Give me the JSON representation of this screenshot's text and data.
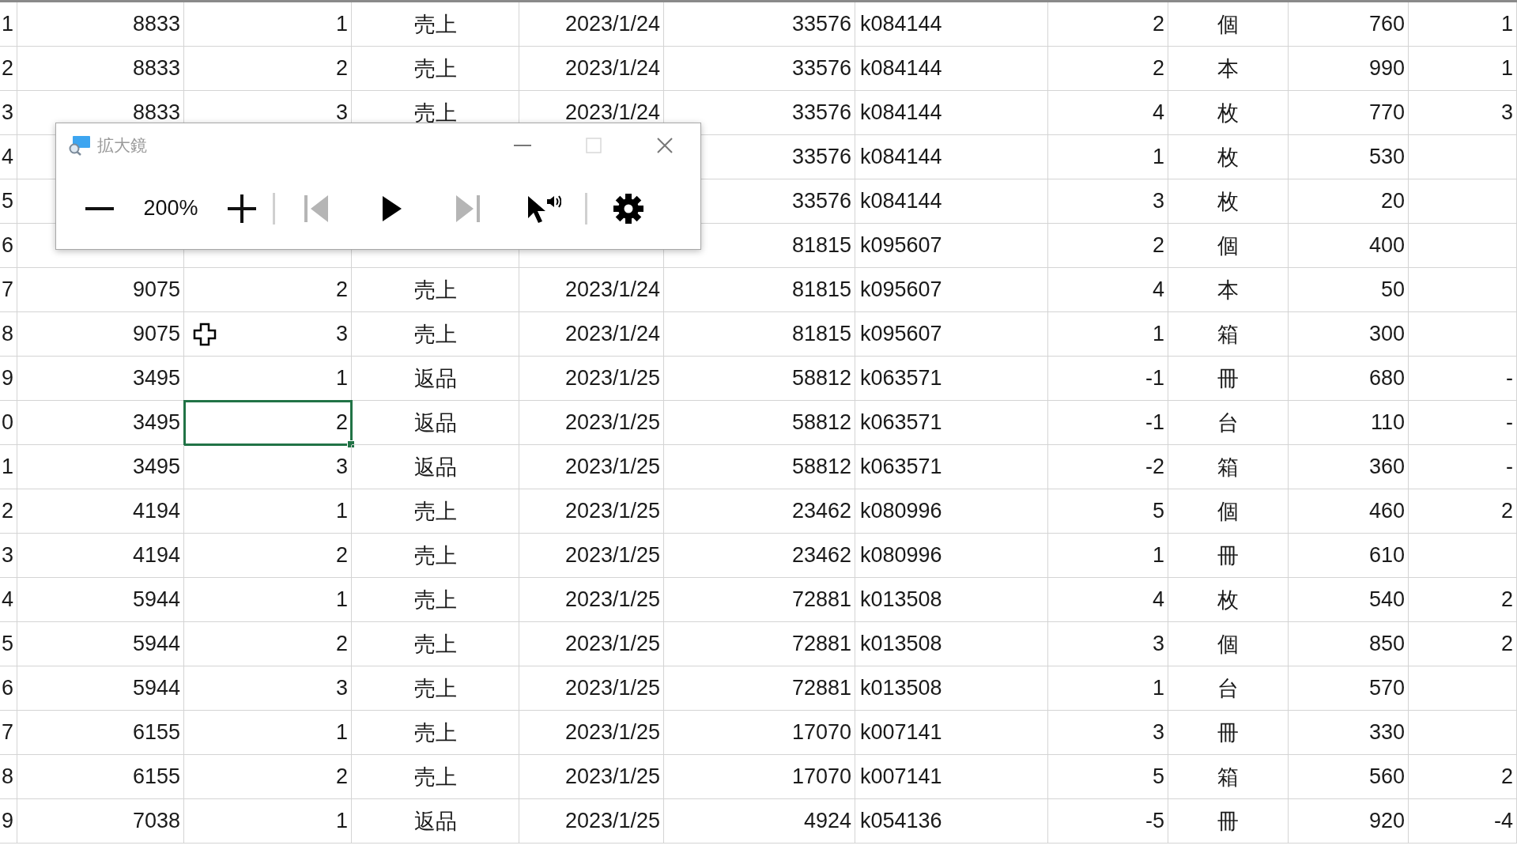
{
  "sheet": {
    "rows": [
      {
        "cells": [
          {
            "text": "1",
            "selected": false
          },
          {
            "text": "8833",
            "selected": false
          },
          {
            "text": "1",
            "selected": false
          },
          {
            "text": "売上",
            "selected": false
          },
          {
            "text": "2023/1/24",
            "selected": false
          },
          {
            "text": "33576",
            "selected": false
          },
          {
            "text": "k084144",
            "selected": false
          },
          {
            "text": "2",
            "selected": false
          },
          {
            "text": "個",
            "selected": false
          },
          {
            "text": "760",
            "selected": false
          },
          {
            "text": "1",
            "selected": false
          }
        ]
      },
      {
        "cells": [
          {
            "text": "2",
            "selected": false
          },
          {
            "text": "8833",
            "selected": false
          },
          {
            "text": "2",
            "selected": false
          },
          {
            "text": "売上",
            "selected": false
          },
          {
            "text": "2023/1/24",
            "selected": false
          },
          {
            "text": "33576",
            "selected": false
          },
          {
            "text": "k084144",
            "selected": false
          },
          {
            "text": "2",
            "selected": false
          },
          {
            "text": "本",
            "selected": false
          },
          {
            "text": "990",
            "selected": false
          },
          {
            "text": "1",
            "selected": false
          }
        ]
      },
      {
        "cells": [
          {
            "text": "3",
            "selected": false
          },
          {
            "text": "8833",
            "selected": false
          },
          {
            "text": "3",
            "selected": false
          },
          {
            "text": "売上",
            "selected": false
          },
          {
            "text": "2023/1/24",
            "selected": false
          },
          {
            "text": "33576",
            "selected": false
          },
          {
            "text": "k084144",
            "selected": false
          },
          {
            "text": "4",
            "selected": false
          },
          {
            "text": "枚",
            "selected": false
          },
          {
            "text": "770",
            "selected": false
          },
          {
            "text": "3",
            "selected": false
          }
        ]
      },
      {
        "cells": [
          {
            "text": "4",
            "selected": false
          },
          null,
          null,
          null,
          null,
          {
            "text": "33576",
            "selected": false
          },
          {
            "text": "k084144",
            "selected": false
          },
          {
            "text": "1",
            "selected": false
          },
          {
            "text": "枚",
            "selected": false
          },
          {
            "text": "530",
            "selected": false
          },
          null
        ]
      },
      {
        "cells": [
          {
            "text": "5",
            "selected": false
          },
          null,
          null,
          null,
          null,
          {
            "text": "33576",
            "selected": false
          },
          {
            "text": "k084144",
            "selected": false
          },
          {
            "text": "3",
            "selected": false
          },
          {
            "text": "枚",
            "selected": false
          },
          {
            "text": "20",
            "selected": false
          },
          null
        ]
      },
      {
        "cells": [
          {
            "text": "6",
            "selected": false
          },
          null,
          null,
          null,
          null,
          {
            "text": "81815",
            "selected": false
          },
          {
            "text": "k095607",
            "selected": false
          },
          {
            "text": "2",
            "selected": false
          },
          {
            "text": "個",
            "selected": false
          },
          {
            "text": "400",
            "selected": false
          },
          null
        ]
      },
      {
        "cells": [
          {
            "text": "7",
            "selected": false
          },
          {
            "text": "9075",
            "selected": false
          },
          {
            "text": "2",
            "selected": false
          },
          {
            "text": "売上",
            "selected": false
          },
          {
            "text": "2023/1/24",
            "selected": false
          },
          {
            "text": "81815",
            "selected": false
          },
          {
            "text": "k095607",
            "selected": false
          },
          {
            "text": "4",
            "selected": false
          },
          {
            "text": "本",
            "selected": false
          },
          {
            "text": "50",
            "selected": false
          },
          null
        ]
      },
      {
        "cells": [
          {
            "text": "8",
            "selected": false
          },
          {
            "text": "9075",
            "selected": false
          },
          {
            "text": "3",
            "selected": false
          },
          {
            "text": "売上",
            "selected": false
          },
          {
            "text": "2023/1/24",
            "selected": false
          },
          {
            "text": "81815",
            "selected": false
          },
          {
            "text": "k095607",
            "selected": false
          },
          {
            "text": "1",
            "selected": false
          },
          {
            "text": "箱",
            "selected": false
          },
          {
            "text": "300",
            "selected": false
          },
          null
        ]
      },
      {
        "cells": [
          {
            "text": "9",
            "selected": false
          },
          {
            "text": "3495",
            "selected": false
          },
          {
            "text": "1",
            "selected": false
          },
          {
            "text": "返品",
            "selected": false
          },
          {
            "text": "2023/1/25",
            "selected": false
          },
          {
            "text": "58812",
            "selected": false
          },
          {
            "text": "k063571",
            "selected": false
          },
          {
            "text": "-1",
            "selected": false
          },
          {
            "text": "冊",
            "selected": false
          },
          {
            "text": "680",
            "selected": false
          },
          {
            "text": "-",
            "selected": false
          }
        ]
      },
      {
        "cells": [
          {
            "text": "0",
            "selected": false
          },
          {
            "text": "3495",
            "selected": false
          },
          {
            "text": "2",
            "selected": true
          },
          {
            "text": "返品",
            "selected": false
          },
          {
            "text": "2023/1/25",
            "selected": false
          },
          {
            "text": "58812",
            "selected": false
          },
          {
            "text": "k063571",
            "selected": false
          },
          {
            "text": "-1",
            "selected": false
          },
          {
            "text": "台",
            "selected": false
          },
          {
            "text": "110",
            "selected": false
          },
          {
            "text": "-",
            "selected": false
          }
        ]
      },
      {
        "cells": [
          {
            "text": "1",
            "selected": false
          },
          {
            "text": "3495",
            "selected": false
          },
          {
            "text": "3",
            "selected": false
          },
          {
            "text": "返品",
            "selected": false
          },
          {
            "text": "2023/1/25",
            "selected": false
          },
          {
            "text": "58812",
            "selected": false
          },
          {
            "text": "k063571",
            "selected": false
          },
          {
            "text": "-2",
            "selected": false
          },
          {
            "text": "箱",
            "selected": false
          },
          {
            "text": "360",
            "selected": false
          },
          {
            "text": "-",
            "selected": false
          }
        ]
      },
      {
        "cells": [
          {
            "text": "2",
            "selected": false
          },
          {
            "text": "4194",
            "selected": false
          },
          {
            "text": "1",
            "selected": false
          },
          {
            "text": "売上",
            "selected": false
          },
          {
            "text": "2023/1/25",
            "selected": false
          },
          {
            "text": "23462",
            "selected": false
          },
          {
            "text": "k080996",
            "selected": false
          },
          {
            "text": "5",
            "selected": false
          },
          {
            "text": "個",
            "selected": false
          },
          {
            "text": "460",
            "selected": false
          },
          {
            "text": "2",
            "selected": false
          }
        ]
      },
      {
        "cells": [
          {
            "text": "3",
            "selected": false
          },
          {
            "text": "4194",
            "selected": false
          },
          {
            "text": "2",
            "selected": false
          },
          {
            "text": "売上",
            "selected": false
          },
          {
            "text": "2023/1/25",
            "selected": false
          },
          {
            "text": "23462",
            "selected": false
          },
          {
            "text": "k080996",
            "selected": false
          },
          {
            "text": "1",
            "selected": false
          },
          {
            "text": "冊",
            "selected": false
          },
          {
            "text": "610",
            "selected": false
          },
          null
        ]
      },
      {
        "cells": [
          {
            "text": "4",
            "selected": false
          },
          {
            "text": "5944",
            "selected": false
          },
          {
            "text": "1",
            "selected": false
          },
          {
            "text": "売上",
            "selected": false
          },
          {
            "text": "2023/1/25",
            "selected": false
          },
          {
            "text": "72881",
            "selected": false
          },
          {
            "text": "k013508",
            "selected": false
          },
          {
            "text": "4",
            "selected": false
          },
          {
            "text": "枚",
            "selected": false
          },
          {
            "text": "540",
            "selected": false
          },
          {
            "text": "2",
            "selected": false
          }
        ]
      },
      {
        "cells": [
          {
            "text": "5",
            "selected": false
          },
          {
            "text": "5944",
            "selected": false
          },
          {
            "text": "2",
            "selected": false
          },
          {
            "text": "売上",
            "selected": false
          },
          {
            "text": "2023/1/25",
            "selected": false
          },
          {
            "text": "72881",
            "selected": false
          },
          {
            "text": "k013508",
            "selected": false
          },
          {
            "text": "3",
            "selected": false
          },
          {
            "text": "個",
            "selected": false
          },
          {
            "text": "850",
            "selected": false
          },
          {
            "text": "2",
            "selected": false
          }
        ]
      },
      {
        "cells": [
          {
            "text": "6",
            "selected": false
          },
          {
            "text": "5944",
            "selected": false
          },
          {
            "text": "3",
            "selected": false
          },
          {
            "text": "売上",
            "selected": false
          },
          {
            "text": "2023/1/25",
            "selected": false
          },
          {
            "text": "72881",
            "selected": false
          },
          {
            "text": "k013508",
            "selected": false
          },
          {
            "text": "1",
            "selected": false
          },
          {
            "text": "台",
            "selected": false
          },
          {
            "text": "570",
            "selected": false
          },
          null
        ]
      },
      {
        "cells": [
          {
            "text": "7",
            "selected": false
          },
          {
            "text": "6155",
            "selected": false
          },
          {
            "text": "1",
            "selected": false
          },
          {
            "text": "売上",
            "selected": false
          },
          {
            "text": "2023/1/25",
            "selected": false
          },
          {
            "text": "17070",
            "selected": false
          },
          {
            "text": "k007141",
            "selected": false
          },
          {
            "text": "3",
            "selected": false
          },
          {
            "text": "冊",
            "selected": false
          },
          {
            "text": "330",
            "selected": false
          },
          null
        ]
      },
      {
        "cells": [
          {
            "text": "8",
            "selected": false
          },
          {
            "text": "6155",
            "selected": false
          },
          {
            "text": "2",
            "selected": false
          },
          {
            "text": "売上",
            "selected": false
          },
          {
            "text": "2023/1/25",
            "selected": false
          },
          {
            "text": "17070",
            "selected": false
          },
          {
            "text": "k007141",
            "selected": false
          },
          {
            "text": "5",
            "selected": false
          },
          {
            "text": "箱",
            "selected": false
          },
          {
            "text": "560",
            "selected": false
          },
          {
            "text": "2",
            "selected": false
          }
        ]
      },
      {
        "cells": [
          {
            "text": "9",
            "selected": false
          },
          {
            "text": "7038",
            "selected": false
          },
          {
            "text": "1",
            "selected": false
          },
          {
            "text": "返品",
            "selected": false
          },
          {
            "text": "2023/1/25",
            "selected": false
          },
          {
            "text": "4924",
            "selected": false
          },
          {
            "text": "k054136",
            "selected": false
          },
          {
            "text": "-5",
            "selected": false
          },
          {
            "text": "冊",
            "selected": false
          },
          {
            "text": "920",
            "selected": false
          },
          {
            "text": "-4",
            "selected": false
          }
        ]
      }
    ]
  },
  "magnifier": {
    "title": "拡大鏡",
    "window_buttons": [
      {
        "kind": "minimize",
        "disabled": false
      },
      {
        "kind": "maximize",
        "disabled": true
      },
      {
        "kind": "close",
        "disabled": false
      }
    ],
    "zoom_level": "200%",
    "controls": [
      {
        "kind": "previous",
        "disabled": true
      },
      {
        "kind": "play",
        "disabled": false
      },
      {
        "kind": "next",
        "disabled": true
      },
      {
        "kind": "read_from_pointer",
        "disabled": false
      },
      {
        "kind": "settings",
        "disabled": false
      }
    ]
  }
}
